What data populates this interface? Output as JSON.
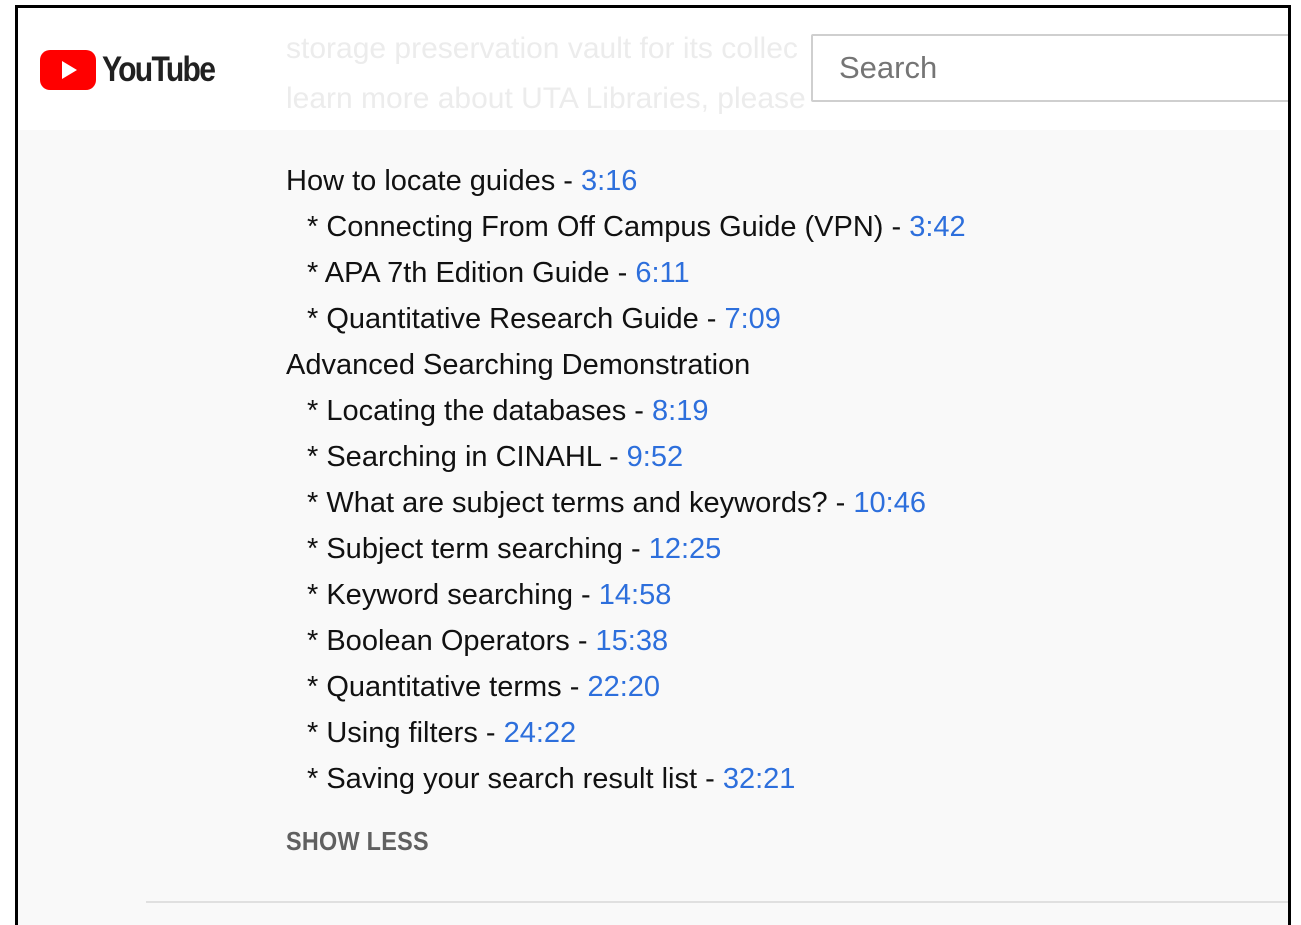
{
  "header": {
    "logo_text": "YouTube",
    "background_text_line1": "storage preservation vault for its collec",
    "background_text_line2": "learn more about UTA Libraries, please",
    "search_placeholder": "Search",
    "brand_red": "#ff0000"
  },
  "chapters": [
    {
      "label": "How to locate guides - ",
      "time": "3:16",
      "sub": false
    },
    {
      "label": "* Connecting From Off Campus Guide (VPN) - ",
      "time": "3:42",
      "sub": true
    },
    {
      "label": "* APA 7th Edition Guide - ",
      "time": "6:11",
      "sub": true
    },
    {
      "label": "* Quantitative Research Guide - ",
      "time": "7:09",
      "sub": true
    },
    {
      "label": "Advanced Searching Demonstration",
      "time": "",
      "sub": false
    },
    {
      "label": "* Locating the databases - ",
      "time": "8:19",
      "sub": true
    },
    {
      "label": "* Searching in CINAHL - ",
      "time": "9:52",
      "sub": true
    },
    {
      "label": "* What are subject terms and keywords? - ",
      "time": "10:46",
      "sub": true
    },
    {
      "label": "* Subject term searching - ",
      "time": "12:25",
      "sub": true
    },
    {
      "label": "* Keyword searching - ",
      "time": "14:58",
      "sub": true
    },
    {
      "label": "* Boolean Operators - ",
      "time": "15:38",
      "sub": true
    },
    {
      "label": "* Quantitative terms - ",
      "time": "22:20",
      "sub": true
    },
    {
      "label": "* Using filters - ",
      "time": "24:22",
      "sub": true
    },
    {
      "label": "* Saving your search result list - ",
      "time": "32:21",
      "sub": true
    }
  ],
  "show_less_label": "SHOW LESS",
  "colors": {
    "timestamp_link": "#2d6fdc",
    "text": "#111111",
    "description_bg": "#f9f9f9"
  }
}
